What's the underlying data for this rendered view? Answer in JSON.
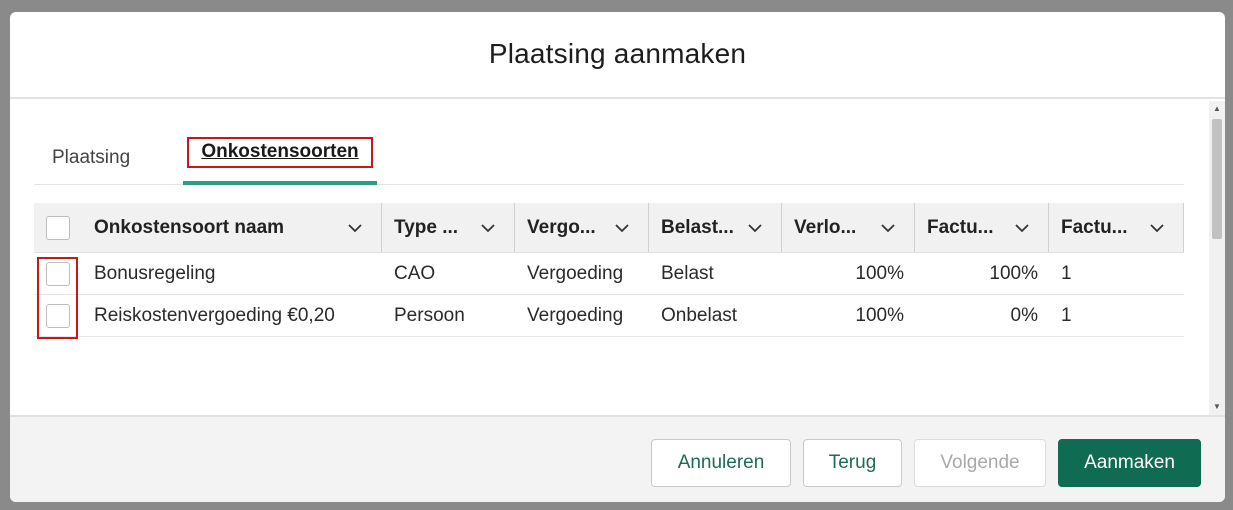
{
  "dialog": {
    "title": "Plaatsing aanmaken"
  },
  "tabs": [
    {
      "label": "Plaatsing"
    },
    {
      "label": "Onkostensoorten"
    }
  ],
  "grid": {
    "columns": [
      {
        "label": "Onkostensoort naam"
      },
      {
        "label": "Type ..."
      },
      {
        "label": "Vergo..."
      },
      {
        "label": "Belast..."
      },
      {
        "label": "Verlo..."
      },
      {
        "label": "Factu..."
      },
      {
        "label": "Factu..."
      }
    ],
    "rows": [
      {
        "naam": "Bonusregeling",
        "type": "CAO",
        "vergoeding": "Vergoeding",
        "belast": "Belast",
        "verloning": "100%",
        "facturatie_pct": "100%",
        "facturatie": "1"
      },
      {
        "naam": "Reiskostenvergoeding €0,20",
        "type": "Persoon",
        "vergoeding": "Vergoeding",
        "belast": "Onbelast",
        "verloning": "100%",
        "facturatie_pct": "0%",
        "facturatie": "1"
      }
    ]
  },
  "footer": {
    "annuleren": "Annuleren",
    "terug": "Terug",
    "volgende": "Volgende",
    "aanmaken": "Aanmaken"
  },
  "colors": {
    "accent": "#2a9d82",
    "primary_button": "#0f6b52",
    "highlight": "#c8161d"
  }
}
